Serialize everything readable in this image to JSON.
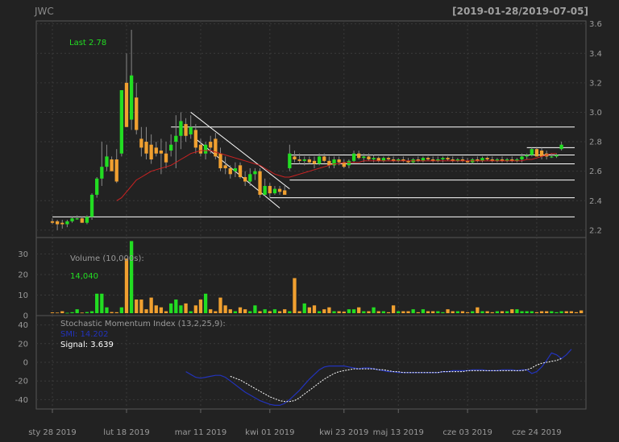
{
  "header": {
    "symbol": "JWC",
    "range": "[2019-01-28/2019-07-05]"
  },
  "colors": {
    "background": "#222222",
    "panel_border": "#555555",
    "grid": "#3a3a3a",
    "up_candle": "#22dd22",
    "down_candle": "#f0a030",
    "ma_line": "#cc2222",
    "highlight_text": "#22dd22",
    "smi_line": "#2233bb",
    "signal_line": "#ffffff",
    "support_lines": "#ffffff"
  },
  "chart_data": [
    {
      "type": "candlestick",
      "panel": "price",
      "annotation": "Last 2.78",
      "ylim": [
        2.15,
        3.62
      ],
      "yticks": [
        2.2,
        2.4,
        2.6,
        2.8,
        3.0,
        3.2,
        3.4,
        3.6
      ],
      "ytick_labels": [
        "2.2",
        "2.4",
        "2.6",
        "2.8",
        "3.0",
        "3.2",
        "3.4",
        "3.6"
      ],
      "xlim": [
        0,
        106
      ],
      "xticks": [
        0,
        15,
        30,
        44,
        59,
        70,
        84,
        98
      ],
      "xtick_labels": [
        "sty 28 2019",
        "lut 18 2019",
        "mar 11 2019",
        "kwi 01 2019",
        "kwi 23 2019",
        "maj 13 2019",
        "cze 03 2019",
        "cze 24 2019"
      ],
      "candles": [
        {
          "o": 2.26,
          "h": 2.28,
          "l": 2.24,
          "c": 2.25
        },
        {
          "o": 2.26,
          "h": 2.27,
          "l": 2.2,
          "c": 2.24
        },
        {
          "o": 2.25,
          "h": 2.27,
          "l": 2.21,
          "c": 2.24
        },
        {
          "o": 2.24,
          "h": 2.27,
          "l": 2.22,
          "c": 2.26
        },
        {
          "o": 2.26,
          "h": 2.29,
          "l": 2.25,
          "c": 2.28
        },
        {
          "o": 2.28,
          "h": 2.3,
          "l": 2.27,
          "c": 2.28
        },
        {
          "o": 2.28,
          "h": 2.29,
          "l": 2.25,
          "c": 2.25
        },
        {
          "o": 2.25,
          "h": 2.3,
          "l": 2.24,
          "c": 2.29
        },
        {
          "o": 2.29,
          "h": 2.45,
          "l": 2.27,
          "c": 2.44
        },
        {
          "o": 2.44,
          "h": 2.56,
          "l": 2.42,
          "c": 2.55
        },
        {
          "o": 2.55,
          "h": 2.8,
          "l": 2.5,
          "c": 2.63
        },
        {
          "o": 2.63,
          "h": 2.78,
          "l": 2.6,
          "c": 2.7
        },
        {
          "o": 2.68,
          "h": 2.7,
          "l": 2.6,
          "c": 2.6
        },
        {
          "o": 2.68,
          "h": 2.75,
          "l": 2.52,
          "c": 2.53
        },
        {
          "o": 2.72,
          "h": 2.92,
          "l": 2.7,
          "c": 3.15
        },
        {
          "o": 3.2,
          "h": 3.4,
          "l": 2.9,
          "c": 2.9
        },
        {
          "o": 2.95,
          "h": 3.56,
          "l": 2.88,
          "c": 3.25
        },
        {
          "o": 3.1,
          "h": 3.2,
          "l": 2.85,
          "c": 2.88
        },
        {
          "o": 2.82,
          "h": 2.9,
          "l": 2.7,
          "c": 2.76
        },
        {
          "o": 2.8,
          "h": 2.9,
          "l": 2.68,
          "c": 2.72
        },
        {
          "o": 2.78,
          "h": 2.85,
          "l": 2.65,
          "c": 2.68
        },
        {
          "o": 2.76,
          "h": 2.8,
          "l": 2.7,
          "c": 2.72
        },
        {
          "o": 2.74,
          "h": 2.82,
          "l": 2.58,
          "c": 2.72
        },
        {
          "o": 2.72,
          "h": 2.8,
          "l": 2.62,
          "c": 2.66
        },
        {
          "o": 2.74,
          "h": 2.85,
          "l": 2.7,
          "c": 2.78
        },
        {
          "o": 2.8,
          "h": 2.98,
          "l": 2.62,
          "c": 2.84
        },
        {
          "o": 2.84,
          "h": 3.0,
          "l": 2.75,
          "c": 2.94
        },
        {
          "o": 2.92,
          "h": 2.96,
          "l": 2.8,
          "c": 2.84
        },
        {
          "o": 2.85,
          "h": 2.98,
          "l": 2.82,
          "c": 2.9
        },
        {
          "o": 2.88,
          "h": 2.92,
          "l": 2.72,
          "c": 2.76
        },
        {
          "o": 2.78,
          "h": 2.82,
          "l": 2.7,
          "c": 2.72
        },
        {
          "o": 2.72,
          "h": 2.8,
          "l": 2.68,
          "c": 2.78
        },
        {
          "o": 2.8,
          "h": 2.84,
          "l": 2.72,
          "c": 2.76
        },
        {
          "o": 2.82,
          "h": 2.86,
          "l": 2.68,
          "c": 2.7
        },
        {
          "o": 2.72,
          "h": 2.76,
          "l": 2.6,
          "c": 2.62
        },
        {
          "o": 2.64,
          "h": 2.7,
          "l": 2.58,
          "c": 2.62
        },
        {
          "o": 2.62,
          "h": 2.64,
          "l": 2.55,
          "c": 2.58
        },
        {
          "o": 2.6,
          "h": 2.66,
          "l": 2.56,
          "c": 2.62
        },
        {
          "o": 2.64,
          "h": 2.66,
          "l": 2.55,
          "c": 2.56
        },
        {
          "o": 2.56,
          "h": 2.6,
          "l": 2.5,
          "c": 2.53
        },
        {
          "o": 2.53,
          "h": 2.62,
          "l": 2.5,
          "c": 2.58
        },
        {
          "o": 2.58,
          "h": 2.62,
          "l": 2.54,
          "c": 2.6
        },
        {
          "o": 2.6,
          "h": 2.62,
          "l": 2.42,
          "c": 2.44
        },
        {
          "o": 2.44,
          "h": 2.55,
          "l": 2.43,
          "c": 2.5
        },
        {
          "o": 2.5,
          "h": 2.52,
          "l": 2.42,
          "c": 2.45
        },
        {
          "o": 2.45,
          "h": 2.5,
          "l": 2.44,
          "c": 2.48
        },
        {
          "o": 2.48,
          "h": 2.5,
          "l": 2.44,
          "c": 2.46
        },
        {
          "o": 2.47,
          "h": 2.5,
          "l": 2.45,
          "c": 2.44
        },
        {
          "o": 2.62,
          "h": 2.78,
          "l": 2.6,
          "c": 2.72
        },
        {
          "o": 2.7,
          "h": 2.74,
          "l": 2.66,
          "c": 2.68
        },
        {
          "o": 2.68,
          "h": 2.72,
          "l": 2.65,
          "c": 2.67
        },
        {
          "o": 2.67,
          "h": 2.7,
          "l": 2.64,
          "c": 2.68
        },
        {
          "o": 2.68,
          "h": 2.7,
          "l": 2.65,
          "c": 2.66
        },
        {
          "o": 2.67,
          "h": 2.7,
          "l": 2.62,
          "c": 2.65
        },
        {
          "o": 2.65,
          "h": 2.72,
          "l": 2.64,
          "c": 2.7
        },
        {
          "o": 2.7,
          "h": 2.72,
          "l": 2.66,
          "c": 2.67
        },
        {
          "o": 2.67,
          "h": 2.7,
          "l": 2.62,
          "c": 2.64
        },
        {
          "o": 2.64,
          "h": 2.7,
          "l": 2.62,
          "c": 2.68
        },
        {
          "o": 2.68,
          "h": 2.7,
          "l": 2.64,
          "c": 2.66
        },
        {
          "o": 2.66,
          "h": 2.68,
          "l": 2.62,
          "c": 2.63
        },
        {
          "o": 2.64,
          "h": 2.68,
          "l": 2.62,
          "c": 2.67
        },
        {
          "o": 2.67,
          "h": 2.74,
          "l": 2.66,
          "c": 2.72
        },
        {
          "o": 2.72,
          "h": 2.74,
          "l": 2.68,
          "c": 2.69
        },
        {
          "o": 2.69,
          "h": 2.72,
          "l": 2.66,
          "c": 2.7
        },
        {
          "o": 2.7,
          "h": 2.72,
          "l": 2.67,
          "c": 2.68
        },
        {
          "o": 2.68,
          "h": 2.71,
          "l": 2.66,
          "c": 2.69
        },
        {
          "o": 2.69,
          "h": 2.7,
          "l": 2.66,
          "c": 2.67
        },
        {
          "o": 2.67,
          "h": 2.7,
          "l": 2.66,
          "c": 2.69
        },
        {
          "o": 2.69,
          "h": 2.7,
          "l": 2.67,
          "c": 2.68
        },
        {
          "o": 2.68,
          "h": 2.7,
          "l": 2.66,
          "c": 2.67
        },
        {
          "o": 2.67,
          "h": 2.69,
          "l": 2.66,
          "c": 2.68
        },
        {
          "o": 2.68,
          "h": 2.7,
          "l": 2.66,
          "c": 2.67
        },
        {
          "o": 2.67,
          "h": 2.69,
          "l": 2.65,
          "c": 2.66
        },
        {
          "o": 2.66,
          "h": 2.69,
          "l": 2.65,
          "c": 2.68
        },
        {
          "o": 2.68,
          "h": 2.7,
          "l": 2.66,
          "c": 2.67
        },
        {
          "o": 2.67,
          "h": 2.7,
          "l": 2.66,
          "c": 2.69
        },
        {
          "o": 2.69,
          "h": 2.7,
          "l": 2.67,
          "c": 2.68
        },
        {
          "o": 2.68,
          "h": 2.7,
          "l": 2.66,
          "c": 2.67
        },
        {
          "o": 2.67,
          "h": 2.7,
          "l": 2.66,
          "c": 2.68
        },
        {
          "o": 2.68,
          "h": 2.7,
          "l": 2.66,
          "c": 2.69
        },
        {
          "o": 2.69,
          "h": 2.7,
          "l": 2.67,
          "c": 2.68
        },
        {
          "o": 2.68,
          "h": 2.7,
          "l": 2.66,
          "c": 2.67
        },
        {
          "o": 2.67,
          "h": 2.69,
          "l": 2.66,
          "c": 2.68
        },
        {
          "o": 2.68,
          "h": 2.7,
          "l": 2.66,
          "c": 2.67
        },
        {
          "o": 2.67,
          "h": 2.69,
          "l": 2.65,
          "c": 2.66
        },
        {
          "o": 2.66,
          "h": 2.69,
          "l": 2.65,
          "c": 2.68
        },
        {
          "o": 2.68,
          "h": 2.7,
          "l": 2.66,
          "c": 2.67
        },
        {
          "o": 2.67,
          "h": 2.7,
          "l": 2.66,
          "c": 2.69
        },
        {
          "o": 2.69,
          "h": 2.7,
          "l": 2.67,
          "c": 2.68
        },
        {
          "o": 2.68,
          "h": 2.7,
          "l": 2.66,
          "c": 2.67
        },
        {
          "o": 2.67,
          "h": 2.69,
          "l": 2.66,
          "c": 2.68
        },
        {
          "o": 2.68,
          "h": 2.7,
          "l": 2.66,
          "c": 2.67
        },
        {
          "o": 2.67,
          "h": 2.69,
          "l": 2.66,
          "c": 2.68
        },
        {
          "o": 2.68,
          "h": 2.7,
          "l": 2.66,
          "c": 2.67
        },
        {
          "o": 2.67,
          "h": 2.69,
          "l": 2.66,
          "c": 2.68
        },
        {
          "o": 2.68,
          "h": 2.72,
          "l": 2.66,
          "c": 2.7
        },
        {
          "o": 2.7,
          "h": 2.72,
          "l": 2.68,
          "c": 2.71
        },
        {
          "o": 2.71,
          "h": 2.76,
          "l": 2.7,
          "c": 2.75
        },
        {
          "o": 2.75,
          "h": 2.76,
          "l": 2.7,
          "c": 2.7
        },
        {
          "o": 2.74,
          "h": 2.76,
          "l": 2.68,
          "c": 2.7
        },
        {
          "o": 2.72,
          "h": 2.74,
          "l": 2.68,
          "c": 2.7
        },
        {
          "o": 2.7,
          "h": 2.72,
          "l": 2.69,
          "c": 2.7
        },
        {
          "o": 2.7,
          "h": 2.72,
          "l": 2.69,
          "c": 2.71
        },
        {
          "o": 2.75,
          "h": 2.8,
          "l": 2.74,
          "c": 2.78
        }
      ],
      "ma": [
        2.4,
        2.42,
        2.46,
        2.5,
        2.54,
        2.56,
        2.58,
        2.6,
        2.61,
        2.62,
        2.63,
        2.64,
        2.66,
        2.68,
        2.7,
        2.72,
        2.73,
        2.74,
        2.74,
        2.74,
        2.73,
        2.72,
        2.71,
        2.7,
        2.69,
        2.68,
        2.67,
        2.66,
        2.65,
        2.64,
        2.62,
        2.6,
        2.58,
        2.57,
        2.56,
        2.56,
        2.57,
        2.58,
        2.59,
        2.6,
        2.61,
        2.62,
        2.63,
        2.64,
        2.65,
        2.65,
        2.66,
        2.66,
        2.66,
        2.66,
        2.67,
        2.67,
        2.67,
        2.67,
        2.67,
        2.67,
        2.67,
        2.67,
        2.67,
        2.67,
        2.67,
        2.67,
        2.67,
        2.67,
        2.67,
        2.67,
        2.67,
        2.67,
        2.67,
        2.67,
        2.67,
        2.67,
        2.67,
        2.67,
        2.67,
        2.67,
        2.67,
        2.67,
        2.67,
        2.67,
        2.67,
        2.67,
        2.67,
        2.68,
        2.68,
        2.69,
        2.7,
        2.71,
        2.72,
        2.72
      ],
      "ma_start": 13,
      "hlines": [
        {
          "y": 2.9,
          "x0": 24,
          "x1": 106
        },
        {
          "y": 2.29,
          "x0": 0,
          "x1": 106
        },
        {
          "y": 2.71,
          "x0": 48,
          "x1": 106
        },
        {
          "y": 2.65,
          "x0": 48,
          "x1": 106
        },
        {
          "y": 2.54,
          "x0": 48,
          "x1": 106
        },
        {
          "y": 2.42,
          "x0": 44,
          "x1": 106
        },
        {
          "y": 2.76,
          "x0": 96,
          "x1": 106
        },
        {
          "y": 2.71,
          "x0": 96,
          "x1": 106
        }
      ],
      "trendlines": [
        {
          "x0": 28,
          "y0": 3.0,
          "x1": 48,
          "y1": 2.48
        },
        {
          "x0": 29,
          "y0": 2.82,
          "x1": 46,
          "y1": 2.35
        }
      ]
    },
    {
      "type": "bar",
      "panel": "volume",
      "title": "Volume (10,000s):",
      "last_value": "14,040",
      "ylim": [
        0,
        38
      ],
      "yticks": [
        0,
        10,
        20,
        30
      ],
      "ytick_labels": [
        "0",
        "10",
        "20",
        "30"
      ],
      "values": [
        0.4,
        0.3,
        1,
        0.2,
        0.5,
        2,
        0.3,
        0.6,
        1,
        10,
        10,
        3,
        0.6,
        0.5,
        3,
        28,
        37,
        7,
        7,
        2,
        8,
        4,
        3,
        1,
        5,
        7,
        4,
        5,
        1,
        4,
        7,
        10,
        2,
        1,
        8,
        4,
        2,
        1,
        3,
        2,
        1,
        4,
        1,
        2,
        1,
        2,
        1,
        2,
        1,
        18,
        1,
        5,
        3,
        4,
        1,
        2,
        3,
        1,
        1,
        0.8,
        2,
        2,
        3,
        1,
        1,
        3,
        1,
        1,
        0.5,
        4,
        1,
        1,
        1,
        2,
        0.5,
        2,
        1,
        1,
        1,
        0.5,
        2,
        1,
        1,
        1,
        0.5,
        1,
        3,
        1,
        1,
        0.5,
        1,
        1,
        1,
        2,
        2,
        1,
        1,
        1,
        0.5,
        1,
        1,
        1,
        0.5,
        1,
        1,
        1,
        0.5,
        1.4
      ]
    },
    {
      "type": "line",
      "panel": "smi",
      "title": "Stochastic Momentum Index (13,2,25,9):",
      "series_labels": [
        "SMI: 14.202",
        "Signal: 3.639"
      ],
      "ylim": [
        -50,
        50
      ],
      "yticks": [
        -40,
        -20,
        0,
        20,
        40
      ],
      "ytick_labels": [
        "-40",
        "-20",
        "0",
        "20",
        "40"
      ],
      "smi_start": 27,
      "smi": [
        -10,
        -13,
        -16,
        -17,
        -16,
        -15,
        -14,
        -14,
        -16,
        -20,
        -24,
        -28,
        -32,
        -35,
        -38,
        -41,
        -43,
        -45,
        -46,
        -46,
        -44,
        -40,
        -35,
        -30,
        -24,
        -18,
        -13,
        -8,
        -5,
        -4,
        -4,
        -4,
        -4,
        -5,
        -6,
        -7,
        -6,
        -6,
        -7,
        -8,
        -9,
        -10,
        -10,
        -11,
        -11,
        -11,
        -11,
        -11,
        -11,
        -11,
        -11,
        -11,
        -10,
        -10,
        -9,
        -9,
        -9,
        -9,
        -8,
        -8,
        -8,
        -9,
        -9,
        -9,
        -8,
        -8,
        -8,
        -9,
        -8,
        -8,
        -12,
        -10,
        -5,
        2,
        10,
        8,
        4,
        8,
        14
      ],
      "signal_start": 36,
      "signal": [
        -15,
        -17,
        -19,
        -22,
        -25,
        -28,
        -31,
        -34,
        -37,
        -39,
        -41,
        -42,
        -42,
        -41,
        -38,
        -34,
        -30,
        -26,
        -22,
        -18,
        -15,
        -12,
        -10,
        -9,
        -8,
        -7,
        -7,
        -7,
        -7,
        -7,
        -8,
        -8,
        -9,
        -10,
        -10,
        -11,
        -11,
        -11,
        -11,
        -11,
        -11,
        -11,
        -11,
        -10,
        -10,
        -10,
        -10,
        -10,
        -9,
        -9,
        -9,
        -9,
        -9,
        -9,
        -9,
        -9,
        -9,
        -9,
        -9,
        -9,
        -8,
        -6,
        -3,
        -1,
        0,
        1,
        2,
        4
      ]
    }
  ]
}
